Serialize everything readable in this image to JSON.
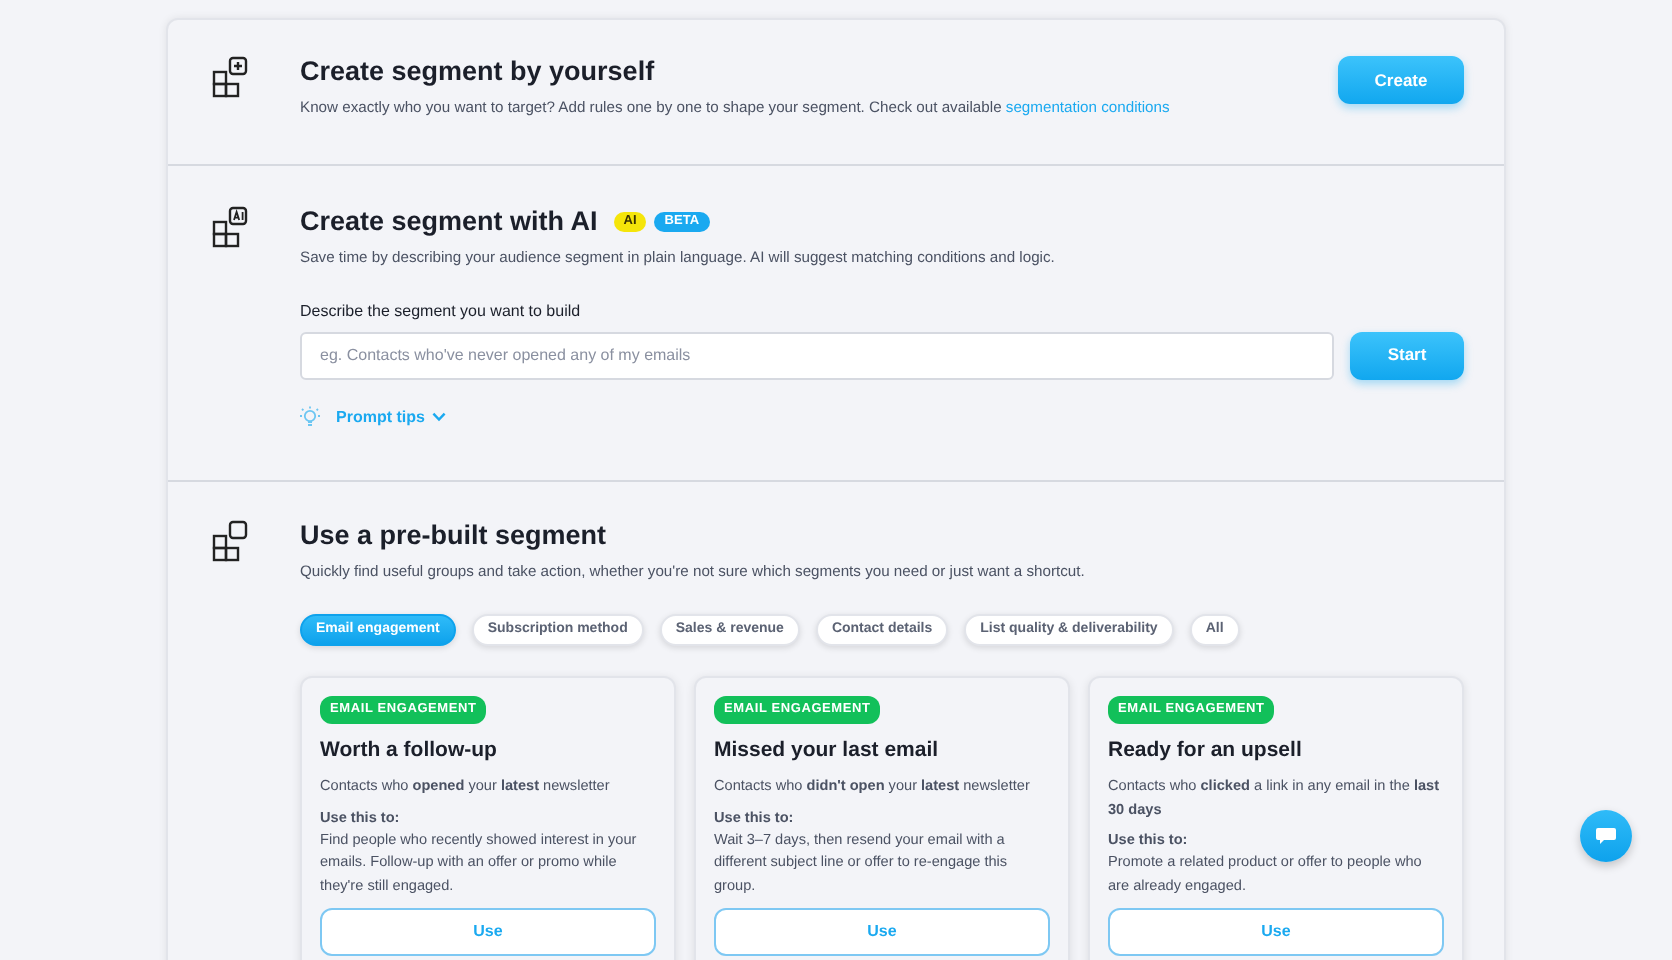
{
  "create_section": {
    "title": "Create segment by yourself",
    "description": "Know exactly who you want to target? Add rules one by one to shape your segment. Check out available ",
    "link": "segmentation conditions",
    "button": "Create"
  },
  "ai_section": {
    "title": "Create segment with AI",
    "badges": [
      {
        "label": "AI",
        "color": "#f5e50a"
      },
      {
        "label": "BETA",
        "color": "#1aa9f0"
      }
    ],
    "description": "Save time by describing your audience segment in plain language. AI will suggest matching conditions and logic.",
    "field_label": "Describe the segment you want to build",
    "placeholder": "eg. Contacts who've never opened any of my emails",
    "button": "Start",
    "tips": "Prompt tips"
  },
  "prebuilt_section": {
    "title": "Use a pre-built segment",
    "description": "Quickly find useful groups and take action, whether you're not sure which segments you need or just want a shortcut.",
    "filters": [
      {
        "label": "Email engagement",
        "selected": true
      },
      {
        "label": "Subscription method",
        "selected": false
      },
      {
        "label": "Sales & revenue",
        "selected": false
      },
      {
        "label": "Contact details",
        "selected": false
      },
      {
        "label": "List quality & deliverability",
        "selected": false
      },
      {
        "label": "All",
        "selected": false
      }
    ],
    "cards": [
      {
        "tag": "EMAIL ENGAGEMENT",
        "title": "Worth a follow-up",
        "summary": "Contacts who **opened** your **latest** newsletter",
        "use_label": "Use this to:",
        "use_text": "Find people who recently showed interest in your emails. Follow-up with an offer or promo while they're still engaged.",
        "button": "Use"
      },
      {
        "tag": "EMAIL ENGAGEMENT",
        "title": "Missed your last email",
        "summary": "Contacts who **didn't open** your **latest** newsletter",
        "use_label": "Use this to:",
        "use_text": "Wait 3–7 days, then resend your email with a different subject line or offer to re-engage this group.",
        "button": "Use"
      },
      {
        "tag": "EMAIL ENGAGEMENT",
        "title": "Ready for an upsell",
        "summary": "Contacts who **clicked** a link in any email in the **last 30 days**",
        "use_label": "Use this to:",
        "use_text": "Promote a related product or offer to people who are already engaged.",
        "button": "Use"
      }
    ]
  }
}
